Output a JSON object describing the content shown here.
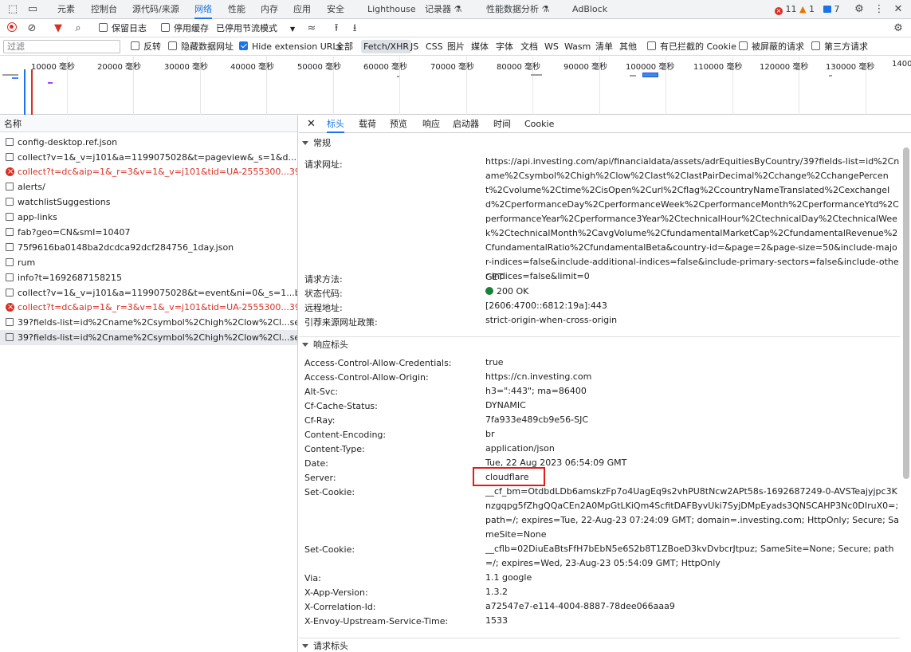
{
  "top_tabs": [
    "元素",
    "控制台",
    "源代码/来源",
    "网络",
    "性能",
    "内存",
    "应用",
    "安全",
    "Lighthouse",
    "记录器 ⚗",
    "性能数据分析 ⚗",
    "AdBlock"
  ],
  "badges": {
    "errors": "11",
    "warnings": "1",
    "messages": "7"
  },
  "toolbar": {
    "preserve_log": "保留日志",
    "disable_cache": "停用缓存",
    "throttle": "已停用节流模式"
  },
  "filter": {
    "placeholder": "过滤",
    "invert": "反转",
    "hide_data_urls": "隐藏数据网址",
    "hide_ext_urls": "Hide extension URLs",
    "types": [
      "全部",
      "Fetch/XHR",
      "JS",
      "CSS",
      "图片",
      "媒体",
      "字体",
      "文档",
      "WS",
      "Wasm",
      "清单",
      "其他"
    ],
    "blocked_cookies": "有已拦截的 Cookie",
    "blocked_requests": "被屏蔽的请求",
    "third_party": "第三方请求"
  },
  "timeline_ticks": [
    "10000 毫秒",
    "20000 毫秒",
    "30000 毫秒",
    "40000 毫秒",
    "50000 毫秒",
    "60000 毫秒",
    "70000 毫秒",
    "80000 毫秒",
    "90000 毫秒",
    "100000 毫秒",
    "110000 毫秒",
    "120000 毫秒",
    "130000 毫秒",
    "1400("
  ],
  "list": {
    "header": "名称",
    "rows": [
      {
        "name": "config-desktop.ref.json",
        "error": false
      },
      {
        "name": "collect?v=1&_v=j101&a=1199075028&t=pageview&_s=1&d...kong-ad...",
        "error": false
      },
      {
        "name": "collect?t=dc&aip=1&_r=3&v=1&_v=j101&tid=UA-2555300...3957.169...",
        "error": true
      },
      {
        "name": "alerts/",
        "error": false
      },
      {
        "name": "watchlistSuggestions",
        "error": false
      },
      {
        "name": "app-links",
        "error": false
      },
      {
        "name": "fab?geo=CN&smI=10407",
        "error": false
      },
      {
        "name": "75f9616ba0148ba2dcdca92dcf284756_1day.json",
        "error": false
      },
      {
        "name": "rum",
        "error": false
      },
      {
        "name": "info?t=1692687158215",
        "error": false
      },
      {
        "name": "collect?v=1&_v=j101&a=1199075028&t=event&ni=0&_s=1...broker&c...",
        "error": false
      },
      {
        "name": "collect?t=dc&aip=1&_r=3&v=1&_v=j101&tid=UA-2555300...3957.169...",
        "error": true
      },
      {
        "name": "39?fields-list=id%2Cname%2Csymbol%2Chigh%2Clow%2Cl...sectors=f...",
        "error": false
      },
      {
        "name": "39?fields-list=id%2Cname%2Csymbol%2Chigh%2Clow%2Cl...sectors=f...",
        "error": false
      }
    ]
  },
  "detail_tabs": [
    "标头",
    "载荷",
    "预览",
    "响应",
    "启动器",
    "时间",
    "Cookie"
  ],
  "general": {
    "title": "常规",
    "url_label": "请求网址:",
    "url": "https://api.investing.com/api/financialdata/assets/adrEquitiesByCountry/39?fields-list=id%2Cname%2Csymbol%2Chigh%2Clow%2Clast%2ClastPairDecimal%2Cchange%2CchangePercent%2Cvolume%2Ctime%2CisOpen%2Curl%2Cflag%2CcountryNameTranslated%2CexchangeId%2CperformanceDay%2CperformanceWeek%2CperformanceMonth%2CperformanceYtd%2CperformanceYear%2Cperformance3Year%2CtechnicalHour%2CtechnicalDay%2CtechnicalWeek%2CtechnicalMonth%2CavgVolume%2CfundamentalMarketCap%2CfundamentalRevenue%2CfundamentalRatio%2CfundamentalBeta&country-id=&page=2&page-size=50&include-major-indices=false&include-additional-indices=false&include-primary-sectors=false&include-other-indices=false&limit=0",
    "method_label": "请求方法:",
    "method": "GET",
    "status_label": "状态代码:",
    "status": "200 OK",
    "remote_label": "远程地址:",
    "remote": "[2606:4700::6812:19a]:443",
    "referrer_label": "引荐来源网址政策:",
    "referrer": "strict-origin-when-cross-origin"
  },
  "response_headers": {
    "title": "响应标头",
    "items": [
      {
        "k": "Access-Control-Allow-Credentials:",
        "v": "true"
      },
      {
        "k": "Access-Control-Allow-Origin:",
        "v": "https://cn.investing.com"
      },
      {
        "k": "Alt-Svc:",
        "v": "h3=\":443\"; ma=86400"
      },
      {
        "k": "Cf-Cache-Status:",
        "v": "DYNAMIC"
      },
      {
        "k": "Cf-Ray:",
        "v": "7fa933e489cb9e56-SJC"
      },
      {
        "k": "Content-Encoding:",
        "v": "br"
      },
      {
        "k": "Content-Type:",
        "v": "application/json"
      },
      {
        "k": "Date:",
        "v": "Tue, 22 Aug 2023 06:54:09 GMT"
      },
      {
        "k": "Server:",
        "v": "cloudflare"
      },
      {
        "k": "Set-Cookie:",
        "v": "__cf_bm=OtdbdLDb6amskzFp7o4UagEq9s2vhPU8tNcw2APt58s-1692687249-0-AVSTeajyjpc3Knzgqpg5fZhgQQaCEn2A0MpGtLKiQm4ScfitDAFByvUki7SyjDMpEyads3QNSCAHP3Nc0DIruX0=; path=/; expires=Tue, 22-Aug-23 07:24:09 GMT; domain=.investing.com; HttpOnly; Secure; SameSite=None"
      },
      {
        "k": "Set-Cookie:",
        "v": "__cflb=02DiuEaBtsFfH7bEbN5e6S2b8T1ZBoeD3kvDvbcrJtpuz; SameSite=None; Secure; path=/; expires=Wed, 23-Aug-23 05:54:09 GMT; HttpOnly"
      },
      {
        "k": "Via:",
        "v": "1.1 google"
      },
      {
        "k": "X-App-Version:",
        "v": "1.3.2"
      },
      {
        "k": "X-Correlation-Id:",
        "v": "a72547e7-e114-4004-8887-78dee066aaa9"
      },
      {
        "k": "X-Envoy-Upstream-Service-Time:",
        "v": "1533"
      }
    ]
  },
  "request_headers": {
    "title": "请求标头"
  },
  "colors": {
    "accent": "#1a73e8",
    "error": "#d93025",
    "status_ok": "#188038",
    "highlight": "#e31b1b"
  }
}
